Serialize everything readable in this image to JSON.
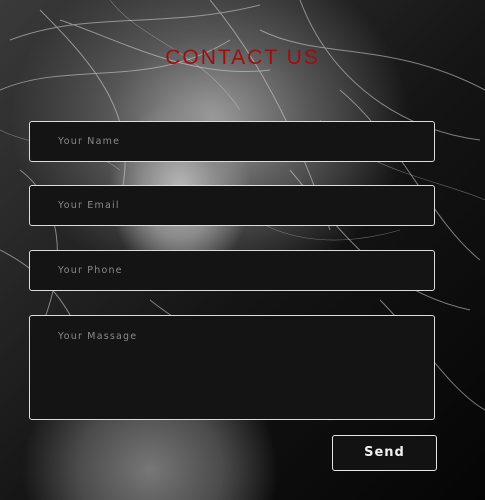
{
  "form": {
    "title": "CONTACT US",
    "name_placeholder": "Your Name",
    "email_placeholder": "Your Email",
    "phone_placeholder": "Your Phone",
    "message_placeholder": "Your Massage",
    "send_label": "Send"
  },
  "colors": {
    "accent": "#9e0e10",
    "field_bg": "#141414",
    "field_border": "#dcdcdc"
  }
}
